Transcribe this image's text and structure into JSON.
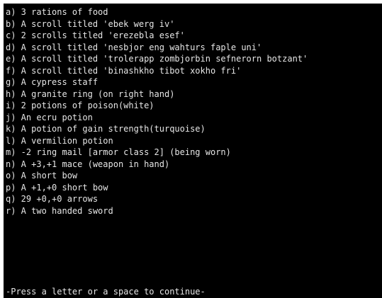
{
  "inventory": [
    "a) 3 rations of food",
    "b) A scroll titled 'ebek werg iv'",
    "c) 2 scrolls titled 'erezebla esef'",
    "d) A scroll titled 'nesbjor eng wahturs faple uni'",
    "e) A scroll titled 'trolerapp zombjorbin sefnerorn botzant'",
    "f) A scroll titled 'binashkho tibot xokho fri'",
    "g) A cypress staff",
    "h) A granite ring (on right hand)",
    "i) 2 potions of poison(white)",
    "j) An ecru potion",
    "k) A potion of gain strength(turquoise)",
    "l) A vermilion potion",
    "m) -2 ring mail [armor class 2] (being worn)",
    "n) A +3,+1 mace (weapon in hand)",
    "o) A short bow",
    "p) A +1,+0 short bow",
    "q) 29 +0,+0 arrows",
    "r) A two handed sword"
  ],
  "prompt": "-Press a letter or a space to continue-",
  "colors": {
    "background": "#000000",
    "text": "#e6e6e6"
  }
}
